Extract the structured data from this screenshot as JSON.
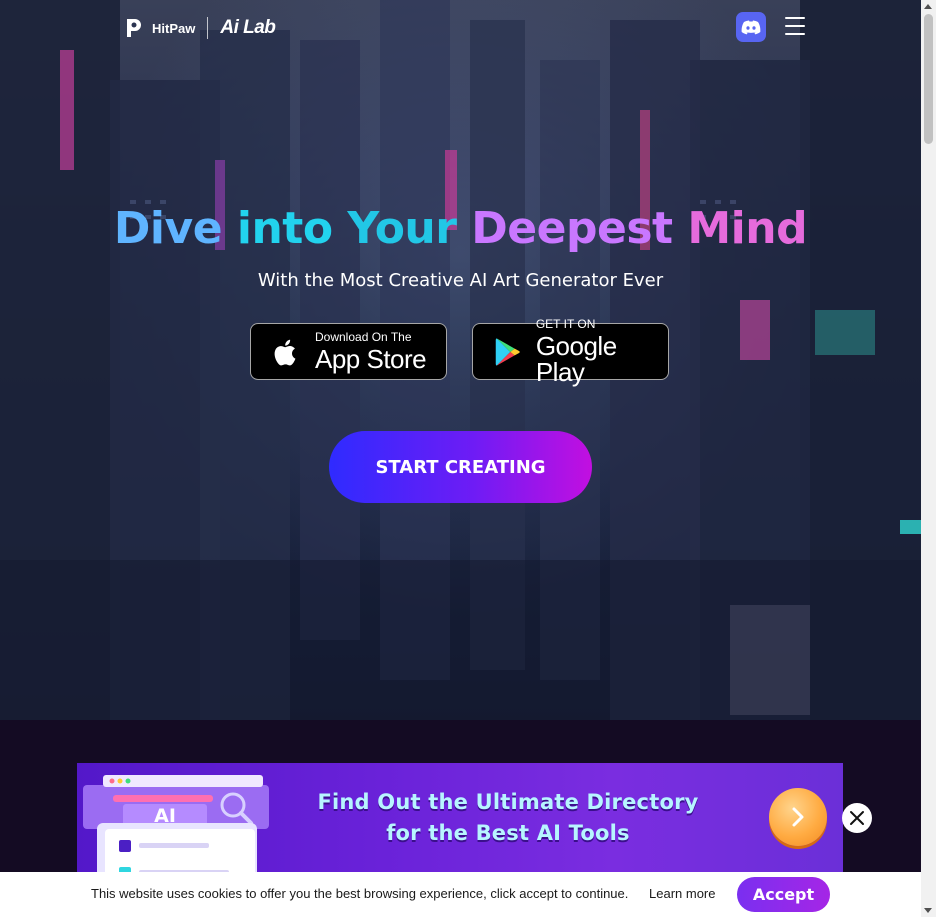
{
  "header": {
    "brand_name": "HitPaw",
    "product_name": "Ai Lab",
    "discord_icon": "discord-icon",
    "menu_icon": "hamburger-menu-icon"
  },
  "hero": {
    "title_words": [
      "Dive",
      "into",
      "Your",
      "Deepest",
      "Mind"
    ],
    "subtitle": "With the Most Creative AI Art Generator Ever",
    "app_store": {
      "small": "Download On The",
      "big": "App Store",
      "icon": "apple-icon"
    },
    "google_play": {
      "small": "GET IT ON",
      "big": "Google Play",
      "icon": "google-play-icon"
    },
    "cta_label": "START CREATING"
  },
  "banner": {
    "badge": "AI",
    "line1": "Find Out the Ultimate Directory",
    "line2": "for the Best AI Tools",
    "arrow_icon": "chevron-right-icon",
    "close_icon": "close-icon"
  },
  "cookie": {
    "message": "This website uses cookies to offer you the best browsing experience, click accept to continue.",
    "learn_more": "Learn more",
    "accept_label": "Accept"
  },
  "colors": {
    "discord": "#5865f2",
    "cta_start": "#2f2bff",
    "cta_end": "#c20fe0",
    "accept": "#8b2bea",
    "banner_bg": "#6a22d9"
  }
}
